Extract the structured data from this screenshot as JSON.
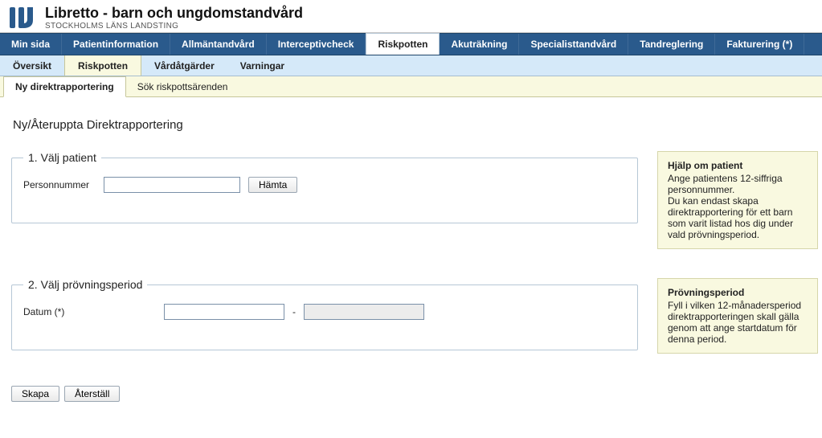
{
  "header": {
    "title": "Libretto - barn och ungdomstandvård",
    "subtitle": "STOCKHOLMS LÄNS LANDSTING"
  },
  "nav_primary": [
    {
      "label": "Min sida"
    },
    {
      "label": "Patientinformation"
    },
    {
      "label": "Allmäntandvård"
    },
    {
      "label": "Interceptivcheck"
    },
    {
      "label": "Riskpotten",
      "active": true
    },
    {
      "label": "Akuträkning"
    },
    {
      "label": "Specialisttandvård"
    },
    {
      "label": "Tandreglering"
    },
    {
      "label": "Fakturering (*)"
    }
  ],
  "nav_secondary": [
    {
      "label": "Översikt"
    },
    {
      "label": "Riskpotten",
      "active": true
    },
    {
      "label": "Vårdåtgärder"
    },
    {
      "label": "Varningar"
    }
  ],
  "nav_tertiary": [
    {
      "label": "Ny direktrapportering",
      "active": true
    },
    {
      "label": "Sök riskpottsärenden"
    }
  ],
  "page": {
    "title": "Ny/Återuppta Direktrapportering",
    "section1": {
      "legend": "1. Välj patient",
      "personnummer_label": "Personnummer",
      "personnummer_value": "",
      "fetch_button": "Hämta"
    },
    "section2": {
      "legend": "2. Välj prövningsperiod",
      "date_label": "Datum (*)",
      "date_from": "",
      "date_to": "",
      "separator": "-"
    },
    "buttons": {
      "create": "Skapa",
      "reset": "Återställ"
    }
  },
  "help": {
    "patient": {
      "title": "Hjälp om patient",
      "body": "Ange patientens 12-siffriga personnummer.\nDu kan endast skapa direktrapportering för ett barn som varit listad hos dig under vald prövningsperiod."
    },
    "period": {
      "title": "Prövningsperiod",
      "body": "Fyll i vilken 12-månadersperiod direktrapporteringen skall gälla genom att ange startdatum för denna period."
    }
  }
}
